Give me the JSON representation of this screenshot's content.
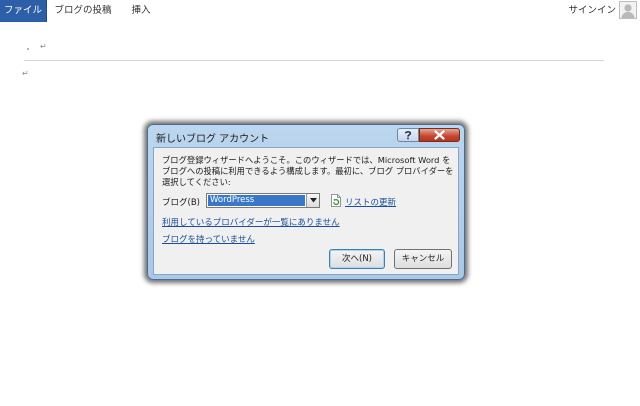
{
  "ribbon": {
    "tabs": [
      "ファイル",
      "ブログの投稿",
      "挿入"
    ],
    "signin_label": "サインイン",
    "avatar_icon": "user-avatar-icon",
    "file_tab_color": "#2c5fa8"
  },
  "document": {
    "paragraph_mark": "↵"
  },
  "dialog": {
    "title": "新しいブログ アカウント",
    "help_icon": "question-mark-icon",
    "close_icon": "close-x-icon",
    "description": "ブログ登録ウィザードへようこそ。このウィザードでは、Microsoft Word をブログへの投稿に利用できるよう構成します。最初に、ブログ プロバイダーを選択してください:",
    "blog_label": "ブログ(B)",
    "provider_value": "WordPress",
    "refresh_icon": "refresh-document-icon",
    "refresh_link": "リストの更新",
    "provider_not_listed_link": "利用しているプロバイダーが一覧にありません",
    "no_blog_link": "ブログを持っていません",
    "next_button": "次へ(N)",
    "cancel_button": "キャンセル",
    "accent_color": "#3a77c9",
    "close_color": "#c4462f"
  }
}
